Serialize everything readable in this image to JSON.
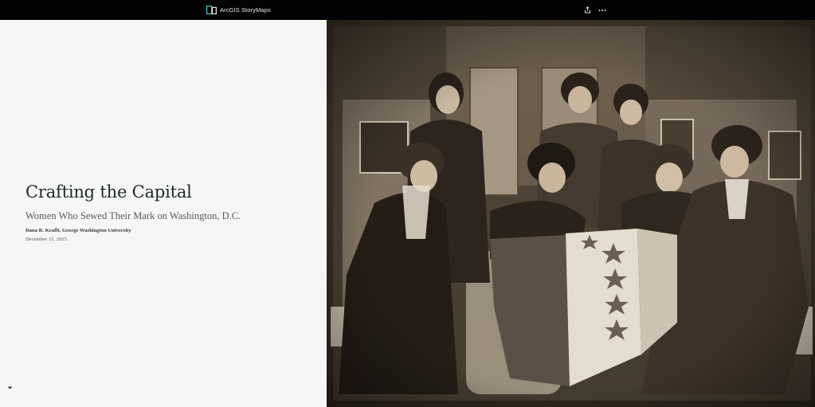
{
  "header": {
    "brand_name": "ArcGIS StoryMaps",
    "brand_icon": "storymaps-logo-icon",
    "actions": [
      {
        "icon": "share-icon"
      },
      {
        "icon": "more-options-icon"
      }
    ]
  },
  "cover": {
    "title": "Crafting the Capital",
    "subtitle": "Women Who Sewed Their Mark on Washington, D.C.",
    "byline": "Dana R. Krafft, George Washington University",
    "date": "December 15, 2025",
    "scroll_icon": "caret-down-icon"
  },
  "colors": {
    "topbar": "#030303",
    "left_panel": "#f6f6f6",
    "title": "#1e2b24",
    "brand_accent": "#4fc3c8"
  }
}
